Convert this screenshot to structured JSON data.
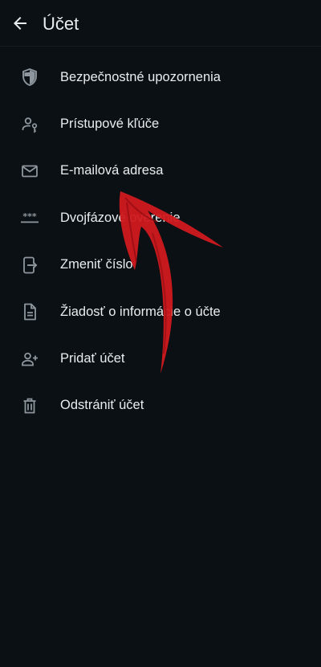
{
  "header": {
    "title": "Účet",
    "back_icon": "arrow-left-icon"
  },
  "menu": {
    "items": [
      {
        "label": "Bezpečnostné upozornenia",
        "icon": "shield-icon"
      },
      {
        "label": "Prístupové kľúče",
        "icon": "passkey-icon"
      },
      {
        "label": "E-mailová adresa",
        "icon": "envelope-icon"
      },
      {
        "label": "Dvojfázové overenie",
        "icon": "asterisks-icon"
      },
      {
        "label": "Zmeniť číslo",
        "icon": "phone-transfer-icon"
      },
      {
        "label": "Žiadosť o informácie o účte",
        "icon": "document-icon"
      },
      {
        "label": "Pridať účet",
        "icon": "add-user-icon"
      },
      {
        "label": "Odstrániť účet",
        "icon": "trash-icon"
      }
    ]
  },
  "colors": {
    "background": "#0b1014",
    "text": "#e9edef",
    "icon": "#8d979d",
    "annotation_arrow": "#d11a1f"
  }
}
